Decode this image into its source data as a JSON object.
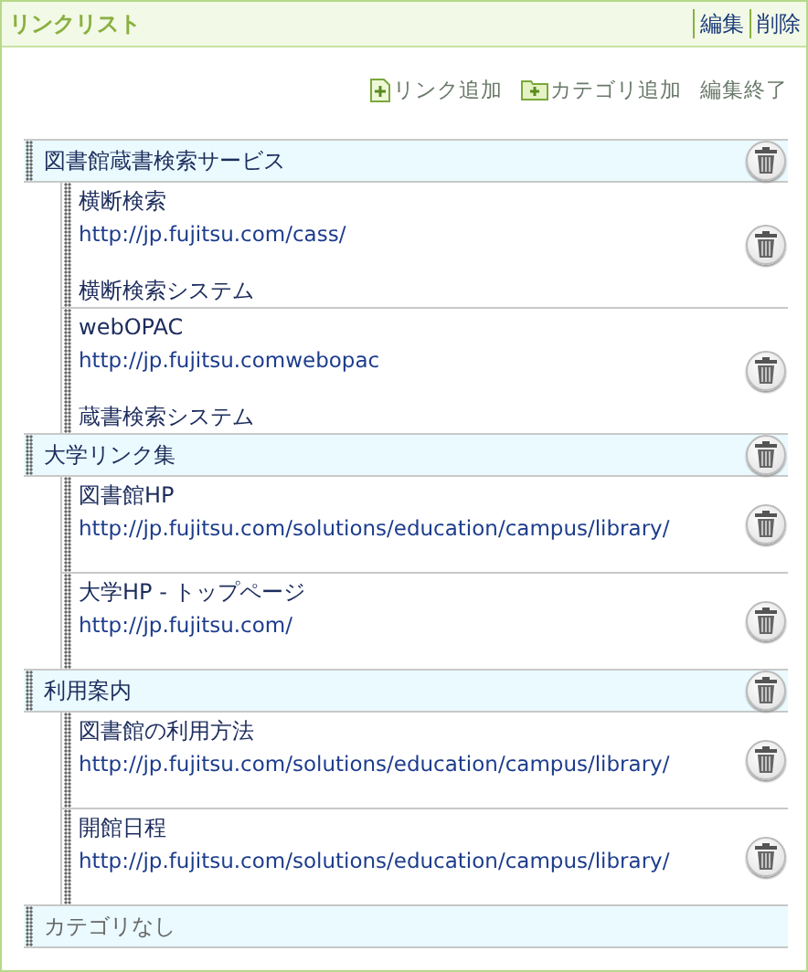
{
  "header": {
    "title": "リンクリスト",
    "actions": [
      "編集",
      "削除"
    ]
  },
  "toolbar": [
    {
      "kind": "add-link",
      "label": "リンク追加"
    },
    {
      "kind": "add-category",
      "label": "カテゴリ追加"
    },
    {
      "kind": "finish",
      "label": "編集終了"
    }
  ],
  "categories": [
    {
      "name": "図書館蔵書検索サービス",
      "deletable": true,
      "links": [
        {
          "title": "横断検索",
          "url": "http://jp.fujitsu.com/cass/",
          "description": "横断検索システム"
        },
        {
          "title": "webOPAC",
          "url": "http://jp.fujitsu.comwebopac",
          "description": "蔵書検索システム"
        }
      ]
    },
    {
      "name": "大学リンク集",
      "deletable": true,
      "links": [
        {
          "title": "図書館HP",
          "url": "http://jp.fujitsu.com/solutions/education/campus/library/"
        },
        {
          "title": "大学HP - トップページ",
          "url": "http://jp.fujitsu.com/"
        }
      ]
    },
    {
      "name": "利用案内",
      "deletable": true,
      "links": [
        {
          "title": "図書館の利用方法",
          "url": "http://jp.fujitsu.com/solutions/education/campus/library/"
        },
        {
          "title": "開館日程",
          "url": "http://jp.fujitsu.com/solutions/education/campus/library/"
        }
      ]
    },
    {
      "name": "カテゴリなし",
      "deletable": false
    }
  ]
}
